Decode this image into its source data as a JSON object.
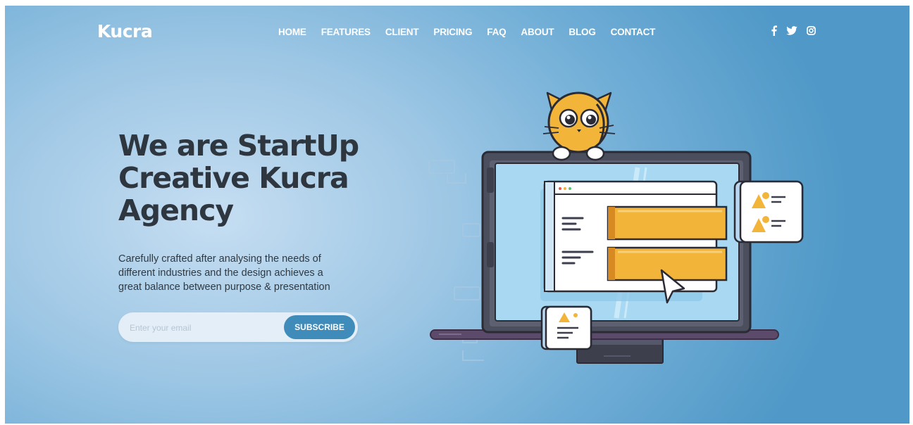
{
  "brand": {
    "logo": "Kucra"
  },
  "nav": {
    "items": [
      {
        "label": "HOME"
      },
      {
        "label": "FEATURES"
      },
      {
        "label": "CLIENT"
      },
      {
        "label": "PRICING"
      },
      {
        "label": "FAQ"
      },
      {
        "label": "ABOUT"
      },
      {
        "label": "BLOG"
      },
      {
        "label": "CONTACT"
      }
    ]
  },
  "social": {
    "icons": [
      "facebook-icon",
      "twitter-icon",
      "instagram-icon"
    ],
    "facebook_glyph": "f",
    "twitter_glyph": "🐦",
    "instagram_glyph": "◎"
  },
  "hero": {
    "headline_lines": [
      "We are StartUp",
      "Creative Kucra",
      "Agency"
    ],
    "description_lines": [
      "Carefully crafted after analysing the needs of",
      "different industries and the design achieves a",
      "great balance between purpose & presentation"
    ]
  },
  "form": {
    "email_placeholder": "Enter your email",
    "email_value": "",
    "subscribe_label": "SUBSCRIBE"
  },
  "colors": {
    "accent": "#3f8bba",
    "headline": "#2e3640",
    "illustration_orange": "#f2b53a",
    "illustration_dark": "#3d3f4c"
  }
}
